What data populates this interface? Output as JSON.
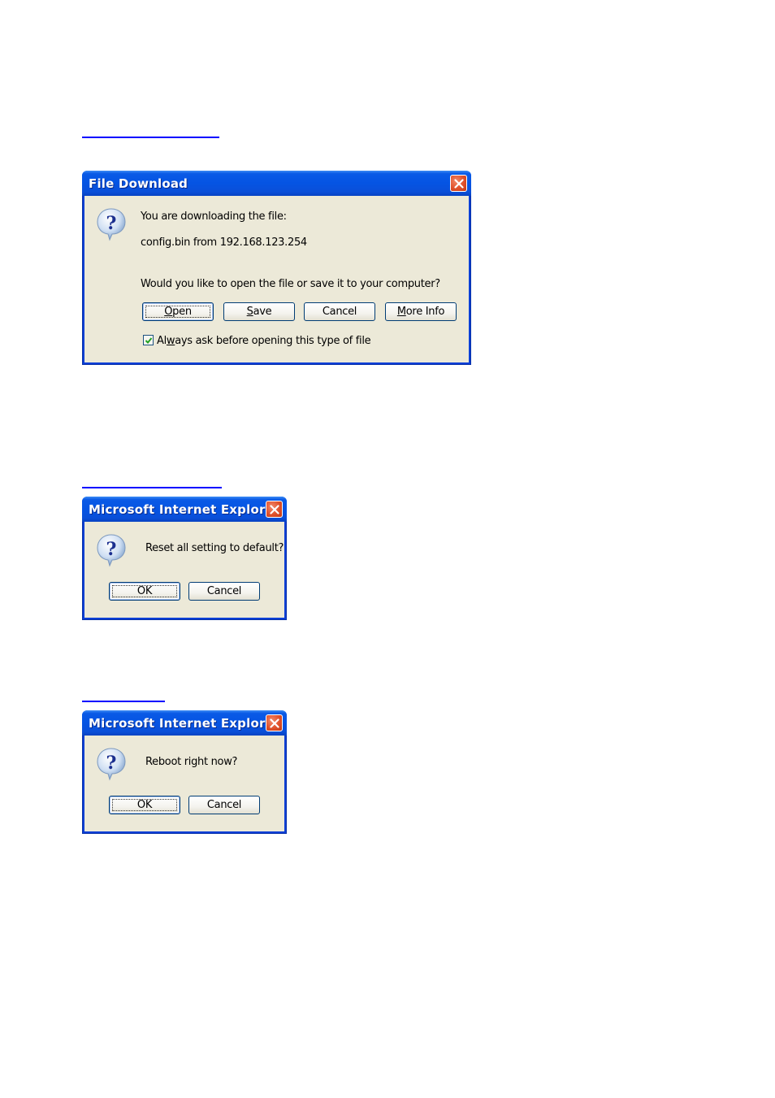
{
  "colors": {
    "link": "#0000ff",
    "title_bar": "#0554e3",
    "dialog_face": "#ece9d8",
    "close_button": "#e0502a",
    "checkmark": "#21a121"
  },
  "file_download": {
    "title": "File Download",
    "line1": "You are downloading the file:",
    "line2": "config.bin from 192.168.123.254",
    "question": "Would you like to open the file or save it to your computer?",
    "buttons": {
      "open": {
        "accel": "O",
        "rest": "pen"
      },
      "save": {
        "accel": "S",
        "rest": "ave"
      },
      "cancel": "Cancel",
      "more_info": {
        "accel": "M",
        "rest": "ore Info"
      }
    },
    "checkbox": {
      "checked": true,
      "pre": "Al",
      "accel": "w",
      "post": "ays ask before opening this type of file"
    }
  },
  "reset_dialog": {
    "title": "Microsoft Internet Explorer",
    "message": "Reset all setting to default?",
    "ok": "OK",
    "cancel": "Cancel"
  },
  "reboot_dialog": {
    "title": "Microsoft Internet Explorer",
    "message": "Reboot right now?",
    "ok": "OK",
    "cancel": "Cancel"
  }
}
